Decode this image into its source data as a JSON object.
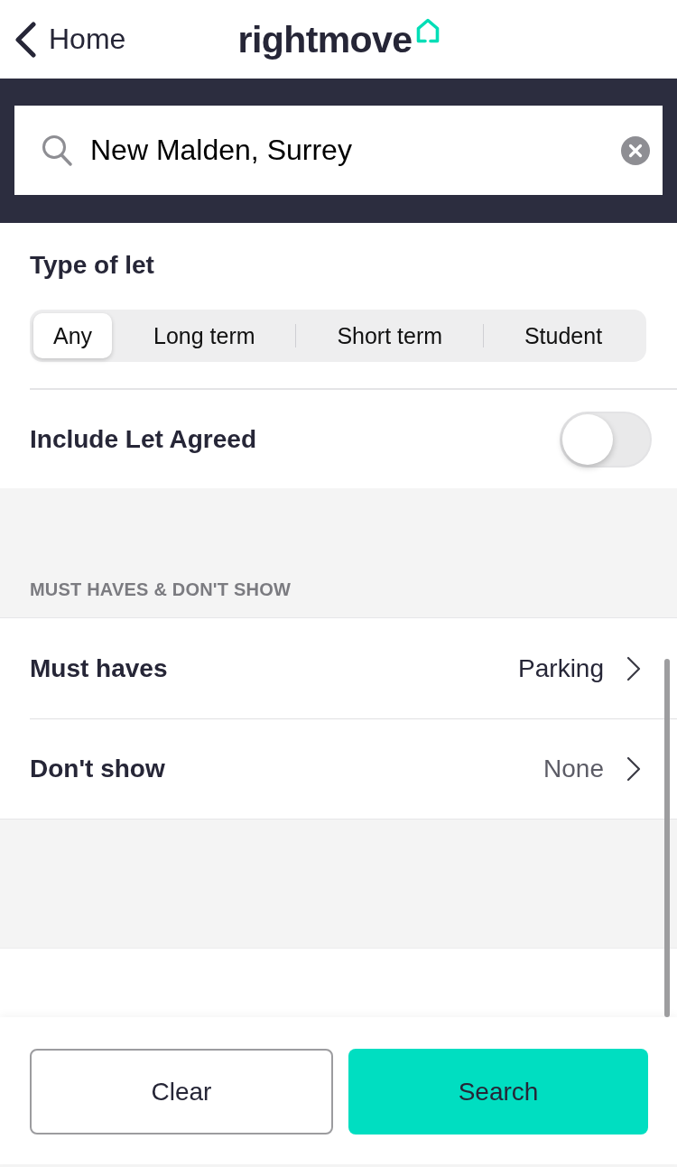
{
  "header": {
    "back": {
      "label": "Home"
    },
    "logo": "rightmove"
  },
  "search": {
    "value": "New Malden, Surrey"
  },
  "type_of_let": {
    "title": "Type of let",
    "options": [
      {
        "label": "Any",
        "selected": true
      },
      {
        "label": "Long term",
        "selected": false
      },
      {
        "label": "Short term",
        "selected": false
      },
      {
        "label": "Student",
        "selected": false
      }
    ]
  },
  "include_let_agreed": {
    "label": "Include Let Agreed",
    "on": false
  },
  "must_haves_section": {
    "header": "MUST HAVES & DON'T SHOW",
    "rows": [
      {
        "label": "Must haves",
        "value": "Parking",
        "active": true
      },
      {
        "label": "Don't show",
        "value": "None",
        "active": false
      }
    ]
  },
  "buttons": [
    {
      "label": "Clear",
      "kind": "secondary"
    },
    {
      "label": "Search",
      "kind": "primary"
    }
  ]
}
